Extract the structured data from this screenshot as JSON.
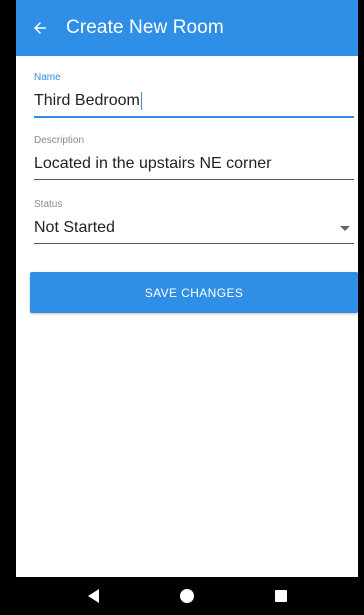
{
  "app_bar": {
    "title": "Create New Room",
    "back_icon": "arrow-left-icon",
    "color": "#2f8fe6"
  },
  "form": {
    "name": {
      "label": "Name",
      "value": "Third Bedroom",
      "focused": true
    },
    "description": {
      "label": "Description",
      "value": "Located in the upstairs NE corner"
    },
    "status": {
      "label": "Status",
      "value": "Not Started",
      "icon": "caret-down-icon"
    }
  },
  "actions": {
    "save_label": "SAVE CHANGES"
  },
  "navigation": {
    "back_icon": "nav-back-icon",
    "home_icon": "nav-home-icon",
    "recents_icon": "nav-recents-icon"
  }
}
